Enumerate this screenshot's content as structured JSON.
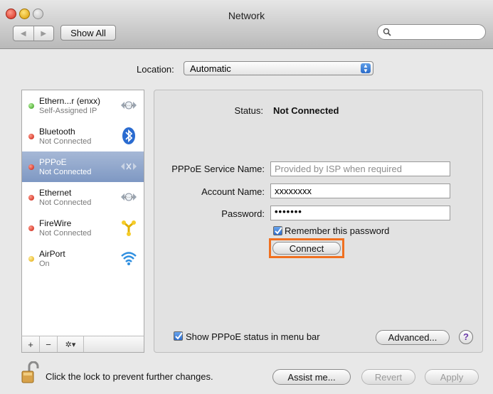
{
  "window": {
    "title": "Network"
  },
  "toolbar": {
    "show_all_label": "Show All",
    "back_icon": "back-arrow-icon",
    "forward_icon": "forward-arrow-icon",
    "search_placeholder": ""
  },
  "location": {
    "label": "Location:",
    "value": "Automatic"
  },
  "services": [
    {
      "name": "Ethern...r (enxx)",
      "status": "Self-Assigned IP",
      "status_color": "green",
      "icon": "ethernet-icon"
    },
    {
      "name": "Bluetooth",
      "status": "Not Connected",
      "status_color": "red",
      "icon": "bluetooth-icon"
    },
    {
      "name": "PPPoE",
      "status": "Not Connected",
      "status_color": "red",
      "icon": "pppoe-icon",
      "selected": true
    },
    {
      "name": "Ethernet",
      "status": "Not Connected",
      "status_color": "red",
      "icon": "ethernet-icon"
    },
    {
      "name": "FireWire",
      "status": "Not Connected",
      "status_color": "red",
      "icon": "firewire-icon"
    },
    {
      "name": "AirPort",
      "status": "On",
      "status_color": "yellow",
      "icon": "airport-icon"
    }
  ],
  "sidebar_footer": {
    "add": "+",
    "remove": "−",
    "gear": "✲▾"
  },
  "detail": {
    "status_label": "Status:",
    "status_value": "Not Connected",
    "service_name_label": "PPPoE Service Name:",
    "service_name_placeholder": "Provided by ISP when required",
    "account_label": "Account Name:",
    "account_value": "xxxxxxxx",
    "password_label": "Password:",
    "password_value": "•••••••",
    "remember_label": "Remember this password",
    "remember_checked": true,
    "connect_label": "Connect",
    "show_status_label": "Show PPPoE status in menu bar",
    "show_status_checked": true,
    "advanced_label": "Advanced...",
    "help_label": "?"
  },
  "footer": {
    "lock_text": "Click the lock to prevent further changes.",
    "assist_label": "Assist me...",
    "revert_label": "Revert",
    "apply_label": "Apply"
  },
  "colors": {
    "highlight_box": "#f07020",
    "selection": "#7e98c3",
    "accent": "#2f6fcf"
  }
}
